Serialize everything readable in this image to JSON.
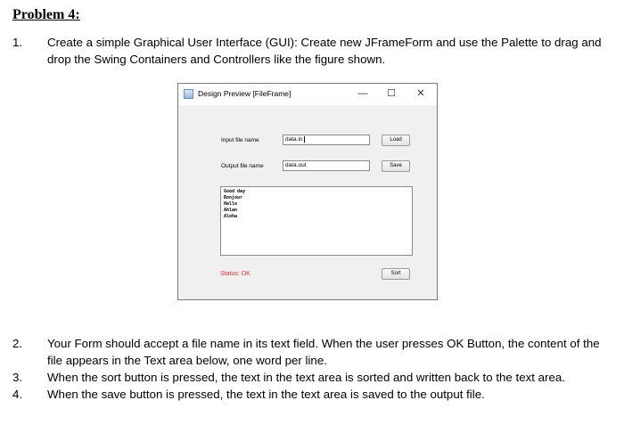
{
  "heading": "Problem 4:",
  "items": [
    {
      "num": "1.",
      "text": "Create a simple Graphical User Interface (GUI): Create new JFrameForm and use the Palette to drag and drop the Swing Containers and Controllers like the figure shown."
    },
    {
      "num": "2.",
      "text": "Your Form should accept a file name in its text field. When the user presses OK Button, the content of the file appears in the Text area below, one word per line."
    },
    {
      "num": "3.",
      "text": "When the sort button is pressed, the text in the text area is sorted and written back to the text area."
    },
    {
      "num": "4.",
      "text": "When the save button is pressed, the text in the text area is saved to the output file."
    }
  ],
  "window": {
    "title": "Design Preview [FileFrame]",
    "controls": {
      "minimize": "—",
      "maximize": "☐",
      "close": "✕"
    },
    "input_label": "Input file name",
    "input_value": "data.in",
    "output_label": "Output file name",
    "output_value": "data.out",
    "load_button": "Load",
    "save_button": "Save",
    "sort_button": "Sort",
    "text_area_lines": [
      "Good day",
      "Bonjour",
      "Hello",
      "Ahlan",
      "Aloha"
    ],
    "status": "Status: OK",
    "status_color": "#e0353a"
  }
}
